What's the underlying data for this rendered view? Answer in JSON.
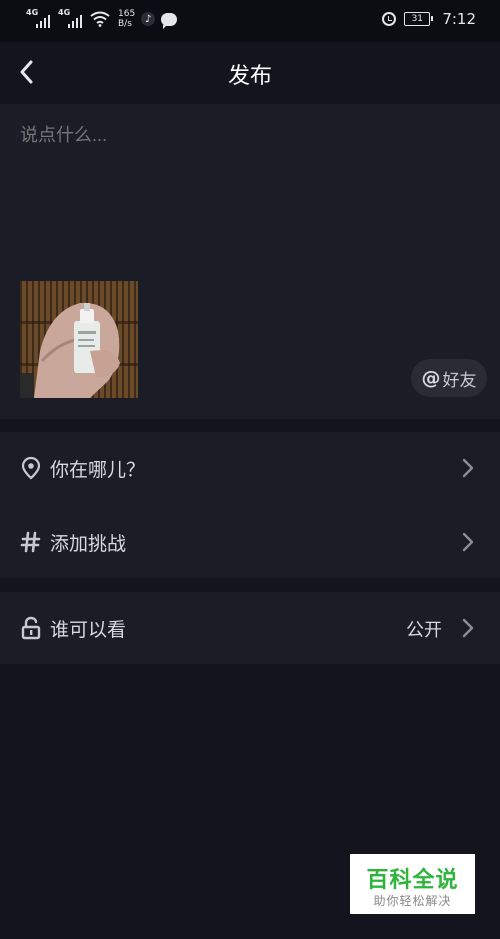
{
  "status_bar": {
    "signal1_tag": "4G",
    "signal2_tag": "4G",
    "net_speed_value": "165",
    "net_speed_unit": "B/s",
    "battery": "31",
    "time": "7:12"
  },
  "header": {
    "back_icon": "chevron-left-icon",
    "title": "发布"
  },
  "compose": {
    "caption_placeholder": "说点什么...",
    "caption_value": "",
    "mention_symbol": "@",
    "mention_label": "好友"
  },
  "options": {
    "location": {
      "icon": "location-pin-icon",
      "label": "你在哪儿？"
    },
    "challenge": {
      "icon": "hashtag-icon",
      "label": "添加挑战"
    },
    "privacy": {
      "icon": "unlock-icon",
      "label": "谁可以看",
      "value": "公开"
    }
  },
  "watermark": {
    "title": "百科全说",
    "subtitle": "助你轻松解决"
  },
  "colors": {
    "background": "#13141e",
    "panel": "#1a1c26",
    "text": "#d8d9de",
    "muted": "#8c8d96",
    "watermark_green": "#2fb33a"
  }
}
